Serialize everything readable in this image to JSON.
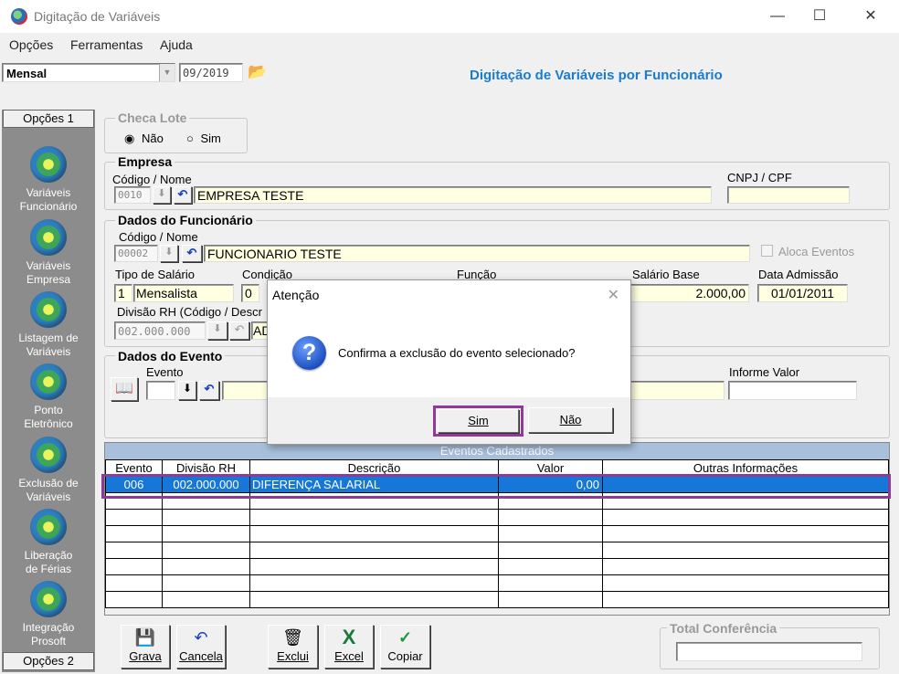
{
  "window": {
    "title": "Digitação de Variáveis",
    "min": "—",
    "max": "☐",
    "close": "✕"
  },
  "menu": [
    "Opções",
    "Ferramentas",
    "Ajuda"
  ],
  "top": {
    "period_type": "Mensal",
    "period": "09/2019",
    "page_title": "Digitação de Variáveis por Funcionário",
    "dropdown_glyph": "▼",
    "folder_glyph": "📂"
  },
  "sidebar": {
    "tab_top": "Opções 1",
    "tab_bottom": "Opções 2",
    "items": [
      {
        "line1": "Variáveis",
        "line2": "Funcionário"
      },
      {
        "line1": "Variáveis",
        "line2": "Empresa"
      },
      {
        "line1": "Listagem de",
        "line2": "Variáveis"
      },
      {
        "line1": "Ponto",
        "line2": "Eletrônico"
      },
      {
        "line1": "Exclusão de",
        "line2": "Variáveis"
      },
      {
        "line1": "Liberação",
        "line2": "de Férias"
      },
      {
        "line1": "Integração",
        "line2": "Prosoft"
      }
    ]
  },
  "checa_lote": {
    "title": "Checa Lote",
    "opt_nao": "Não",
    "opt_sim": "Sim",
    "radio_on": "◉",
    "radio_off": "○"
  },
  "empresa": {
    "title": "Empresa",
    "code_label": "Código / Nome",
    "code": "0010",
    "name": "EMPRESA TESTE",
    "cnpj_label": "CNPJ / CPF",
    "cnpj": ""
  },
  "funcionario": {
    "title": "Dados do Funcionário",
    "code_label": "Código / Nome",
    "code": "00002",
    "name": "FUNCIONARIO TESTE",
    "aloca_label": "Aloca Eventos",
    "tipo_label": "Tipo de Salário",
    "tipo_code": "1",
    "tipo_name": "Mensalista",
    "condicao_label": "Condição",
    "condicao_code": "0",
    "condicao_name": "",
    "funcao_label": "Função",
    "salario_label": "Salário Base",
    "salario": "2.000,00",
    "admissao_label": "Data Admissão",
    "admissao": "01/01/2011",
    "divisao_label": "Divisão RH (Código / Descr",
    "divisao_code": "002.000.000",
    "divisao_name": "AD"
  },
  "evento": {
    "title": "Dados do Evento",
    "evento_label": "Evento",
    "evento": "",
    "informe_label": "Informe Valor",
    "informe": ""
  },
  "glyphs": {
    "down": "⬇",
    "undo": "↶",
    "book": "📖"
  },
  "grid": {
    "caption": "Eventos Cadastrados",
    "columns": [
      "Evento",
      "Divisão RH",
      "Descrição",
      "Valor",
      "Outras Informações"
    ],
    "rows": [
      {
        "evento": "006",
        "divisao": "002.000.000",
        "descricao": "DIFERENÇA SALARIAL",
        "valor": "0,00",
        "outras": ""
      }
    ]
  },
  "toolbar": {
    "grava": "Grava",
    "cancela": "Cancela",
    "exclui": "Exclui",
    "excel": "Excel",
    "copiar": "Copiar",
    "grava_icon": "💾",
    "cancela_icon": "↶",
    "exclui_icon": "🗑",
    "excel_icon": "X",
    "copiar_icon": "✓"
  },
  "total": {
    "title": "Total Conferência",
    "value": ""
  },
  "dialog": {
    "title": "Atenção",
    "close": "✕",
    "icon": "?",
    "message": "Confirma a exclusão do evento selecionado?",
    "yes": "Sim",
    "no": "Não"
  }
}
